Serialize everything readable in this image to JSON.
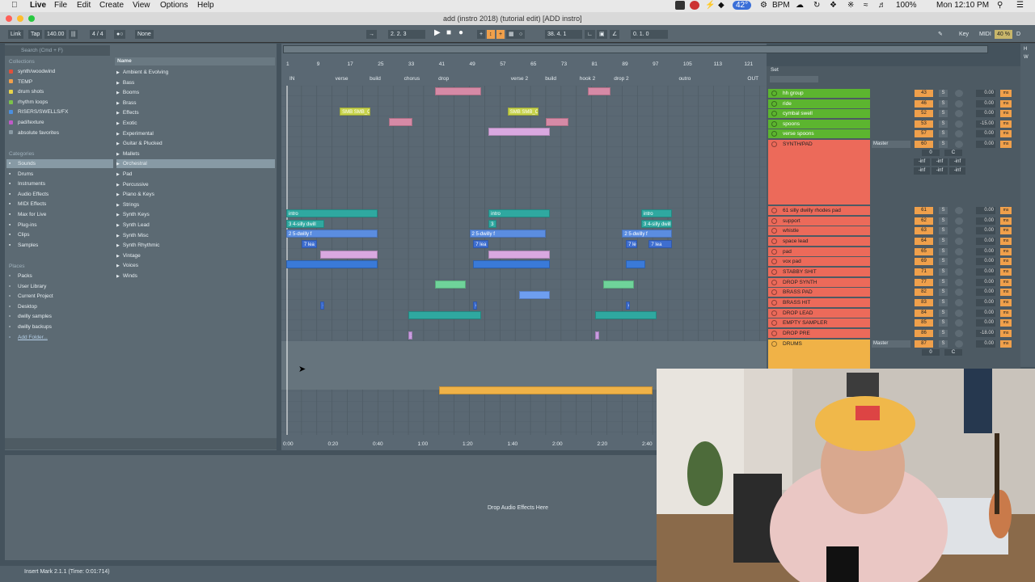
{
  "menubar": {
    "items": [
      "Live",
      "File",
      "Edit",
      "Create",
      "View",
      "Options",
      "Help"
    ],
    "temp": "42°",
    "bpm": "BPM",
    "battery": "100%",
    "clock": "Mon 12:10 PM"
  },
  "window": {
    "title": "add (instro 2018) (tutorial edit)  [ADD instro]"
  },
  "transport": {
    "link": "Link",
    "tap": "Tap",
    "tempo": "140.00",
    "sig": "4 / 4",
    "quant": "None",
    "position": "2.   2.   3",
    "loop_start": "38.   4.   1",
    "loop_len": "0.   1.   0",
    "key": "Key",
    "midi": "MIDI",
    "cpu": "40 %",
    "d": "D"
  },
  "browser": {
    "search_placeholder": "Search (Cmd + F)",
    "collections_title": "Collections",
    "collections": [
      {
        "label": "synth/woodwind",
        "color": "#e0503a"
      },
      {
        "label": "TEMP",
        "color": "#f0a04b"
      },
      {
        "label": "drum shots",
        "color": "#e8d44a"
      },
      {
        "label": "rhythm loops",
        "color": "#7cc24a"
      },
      {
        "label": "RISERS/SWELLS/FX",
        "color": "#4a8fe0"
      },
      {
        "label": "pad/texture",
        "color": "#c05ac8"
      },
      {
        "label": "absolute favorites",
        "color": "#8a9aa4"
      }
    ],
    "categories_title": "Categories",
    "categories": [
      "Sounds",
      "Drums",
      "Instruments",
      "Audio Effects",
      "MIDI Effects",
      "Max for Live",
      "Plug-ins",
      "Clips",
      "Samples"
    ],
    "places_title": "Places",
    "places": [
      "Packs",
      "User Library",
      "Current Project",
      "Desktop",
      "dwilly samples",
      "dwilly backups",
      "Add Folder..."
    ],
    "name_header": "Name",
    "names": [
      "Ambient & Evolving",
      "Bass",
      "Booms",
      "Brass",
      "Effects",
      "Exotic",
      "Experimental",
      "Guitar & Plucked",
      "Mallets",
      "Orchestral",
      "Pad",
      "Percussive",
      "Piano & Keys",
      "Strings",
      "Synth Keys",
      "Synth Lead",
      "Synth Misc",
      "Synth Rhythmic",
      "Vintage",
      "Voices",
      "Winds"
    ]
  },
  "arrangement": {
    "bars": [
      "1",
      "9",
      "17",
      "25",
      "33",
      "41",
      "49",
      "57",
      "65",
      "73",
      "81",
      "89",
      "97",
      "105",
      "113",
      "121"
    ],
    "locators": [
      "IN",
      "verse",
      "build",
      "chorus",
      "drop",
      "verse 2",
      "build",
      "hook 2",
      "drop 2",
      "outro",
      "OUT"
    ],
    "times": [
      "0:00",
      "0:20",
      "0:40",
      "1:00",
      "1:20",
      "1:40",
      "2:00",
      "2:20",
      "2:40"
    ],
    "clip_labels": {
      "smb": "SMB SMB_C",
      "intro": "intro",
      "silly": "3 4-silly dwill",
      "dwilly": "2 5-dwilly f",
      "lead": "7 lea",
      "three": "3",
      "c": "C",
      "one": "1"
    }
  },
  "mixer": {
    "set": "Set",
    "master": "Master",
    "tracks": [
      {
        "name": "hh group",
        "vol": "43",
        "pan": "0.00",
        "color": "#5cb52f"
      },
      {
        "name": "ride",
        "vol": "46",
        "pan": "0.00",
        "color": "#5cb52f"
      },
      {
        "name": "cymbal swell",
        "vol": "52",
        "pan": "0.00",
        "color": "#5cb52f"
      },
      {
        "name": "spoons",
        "vol": "53",
        "pan": "-15.00",
        "color": "#5cb52f"
      },
      {
        "name": "verse spoons",
        "vol": "57",
        "pan": "0.00",
        "color": "#5cb52f"
      },
      {
        "name": "SYNTH/PAD",
        "vol": "60",
        "pan": "0.00",
        "color": "#ec6a5a"
      },
      {
        "name": "61 silly dwilly rhodes pad",
        "vol": "61",
        "pan": "0.00",
        "color": "#ec6a5a"
      },
      {
        "name": "support",
        "vol": "62",
        "pan": "0.00",
        "color": "#ec6a5a"
      },
      {
        "name": "whistle",
        "vol": "63",
        "pan": "0.00",
        "color": "#ec6a5a"
      },
      {
        "name": "space lead",
        "vol": "64",
        "pan": "0.00",
        "color": "#ec6a5a"
      },
      {
        "name": "pad",
        "vol": "65",
        "pan": "0.00",
        "color": "#ec6a5a"
      },
      {
        "name": "vox pad",
        "vol": "69",
        "pan": "0.00",
        "color": "#ec6a5a"
      },
      {
        "name": "STABBY SHIT",
        "vol": "71",
        "pan": "0.00",
        "color": "#ec6a5a"
      },
      {
        "name": "DROP SYNTH",
        "vol": "77",
        "pan": "0.00",
        "color": "#ec6a5a"
      },
      {
        "name": "BRASS PAD",
        "vol": "82",
        "pan": "0.00",
        "color": "#ec6a5a"
      },
      {
        "name": "BRASS HIT",
        "vol": "83",
        "pan": "0.00",
        "color": "#ec6a5a"
      },
      {
        "name": "DROP LEAD",
        "vol": "84",
        "pan": "0.00",
        "color": "#ec6a5a"
      },
      {
        "name": "EMPTY SAMPLER",
        "vol": "85",
        "pan": "0.00",
        "color": "#ec6a5a"
      },
      {
        "name": "DROP PRE",
        "vol": "86",
        "pan": "-18.00",
        "color": "#ec6a5a"
      },
      {
        "name": "DRUMS",
        "vol": "87",
        "pan": "0.00",
        "color": "#f0b247"
      }
    ],
    "inf": "-inf",
    "zero": "0",
    "c": "C",
    "s": "S",
    "ms": "ms"
  },
  "device": {
    "drop_hint": "Drop Audio Effects Here"
  },
  "status": {
    "text": "Insert Mark 2.1.1 (Time: 0:01:714)"
  }
}
